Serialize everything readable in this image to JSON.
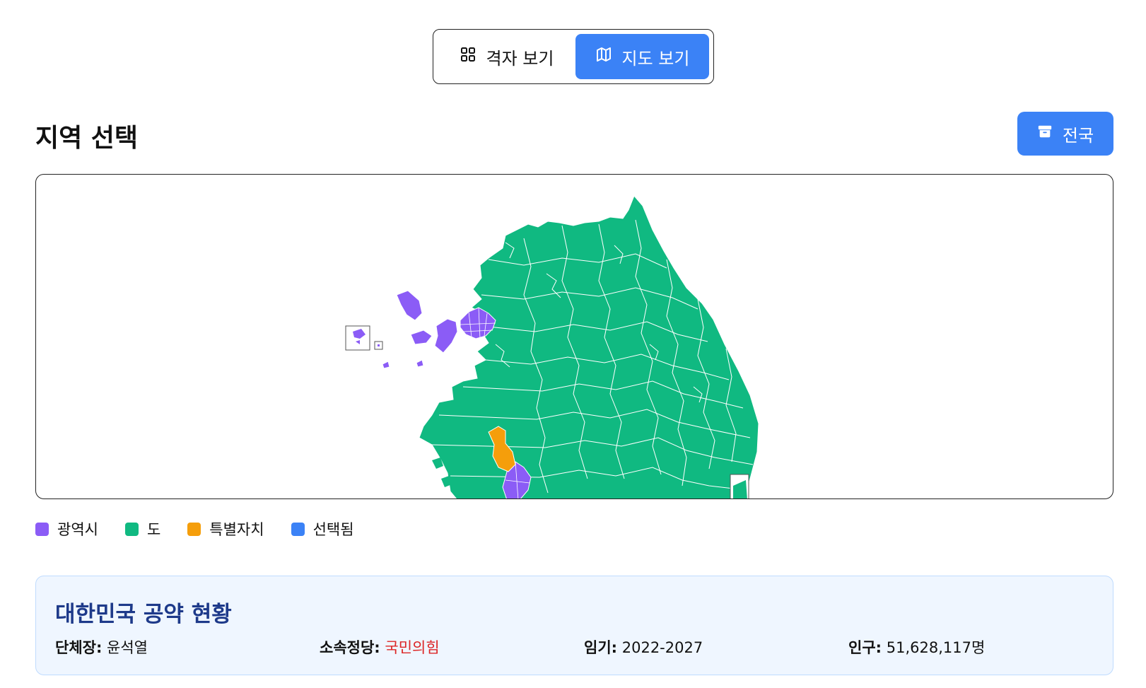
{
  "view_toggle": {
    "grid_label": "격자 보기",
    "map_label": "지도 보기",
    "active": "map"
  },
  "region_select": {
    "title": "지역 선택",
    "national_button": "전국"
  },
  "legend": [
    {
      "label": "광역시",
      "color": "#8b5cf6"
    },
    {
      "label": "도",
      "color": "#10b981"
    },
    {
      "label": "특별자치",
      "color": "#f59e0b"
    },
    {
      "label": "선택됨",
      "color": "#3b82f6"
    }
  ],
  "info": {
    "title": "대한민국 공약 현황",
    "head_label": "단체장:",
    "head_value": "윤석열",
    "party_label": "소속정당:",
    "party_value": "국민의힘",
    "term_label": "임기:",
    "term_value": "2022-2027",
    "population_label": "인구:",
    "population_value": "51,628,117명"
  },
  "colors": {
    "accent": "#3b82f6",
    "metro": "#8b5cf6",
    "province": "#10b981",
    "special": "#f59e0b",
    "party": "#dc2626",
    "card_bg": "#eff6ff",
    "card_title": "#1e3a8a"
  },
  "icons": {
    "grid": "grid-icon",
    "map": "map-icon",
    "archive": "archive-icon"
  }
}
